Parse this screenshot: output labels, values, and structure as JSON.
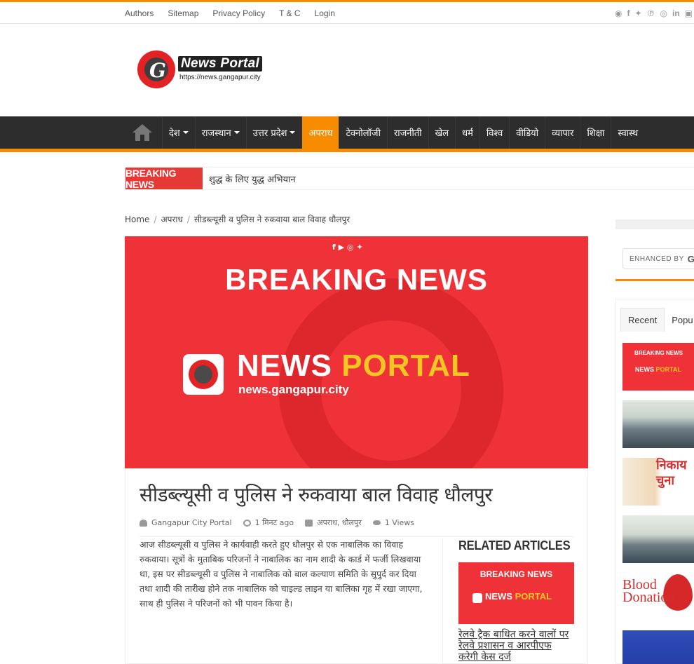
{
  "top_links": [
    "Authors",
    "Sitemap",
    "Privacy Policy",
    "T & C",
    "Login"
  ],
  "social_icons": [
    "rss-icon",
    "facebook-icon",
    "twitter-icon",
    "pinterest-icon",
    "dribbble-icon",
    "linkedin-icon",
    "youtube-icon"
  ],
  "logo": {
    "title": "News Portal",
    "url": "https://news.gangapur.city"
  },
  "nav": {
    "items": [
      {
        "label": "देश",
        "dropdown": true
      },
      {
        "label": "राजस्थान",
        "dropdown": true
      },
      {
        "label": "उत्तर प्रदेश",
        "dropdown": true
      },
      {
        "label": "अपराध",
        "active": true
      },
      {
        "label": "टेक्नोलॉजी"
      },
      {
        "label": "राजनीती"
      },
      {
        "label": "खेल"
      },
      {
        "label": "धर्म"
      },
      {
        "label": "विश्व"
      },
      {
        "label": "वीडियो"
      },
      {
        "label": "व्यापार"
      },
      {
        "label": "शिक्षा"
      },
      {
        "label": "स्वास्थ"
      }
    ]
  },
  "breaking": {
    "label": "BREAKING NEWS",
    "text": "शुद्ध के लिए युद्ध अभियान"
  },
  "breadcrumb": {
    "home": "Home",
    "category": "अपराध",
    "current": "सीडब्ल्यूसी व पुलिस ने रुकवाया बाल विवाह धौलपुर"
  },
  "hero": {
    "headline": "BREAKING NEWS",
    "brand_white": "NEWS ",
    "brand_yellow": "PORTAL",
    "url": "news.gangapur.city",
    "social": "f ▶ ◎ ✦"
  },
  "article": {
    "title": "सीडब्ल्यूसी व पुलिस ने रुकवाया बाल विवाह धौलपुर",
    "author": "Gangapur City Portal",
    "time": "1 मिनट ago",
    "categories": "अपराध, धौलपुर",
    "views": "1 Views",
    "body": "आज सीडब्ल्यूसी व पुलिस ने कार्यवाही करते हुए धौलपुर से एक नाबालिक का विवाह रुकवाया। सूत्रों के मुताबिक परिजनों ने नाबालिक का नाम शादी के कार्ड में फर्जी लिखवाया था, इस पर सीडब्ल्यूसी व पुलिस ने नाबालिक को बाल कल्याण समिति के सुपुर्द कर दिया तथा शादी की तारीख होने तक नाबालिक को चाइल्ड लाइन या बालिका गृह में रखा जाएगा, साथ ही पुलिस ने परिजनों को भी पावन किया है।"
  },
  "related": {
    "title": "RELATED ARTICLES",
    "thumb_headline": "BREAKING NEWS",
    "thumb_brand_white": "NEWS ",
    "thumb_brand_yellow": "PORTAL",
    "link": "रेलवे ट्रैक बाधित करने वालों पर रेलवे प्रशासन व आरपीएफ करेगी केस दर्ज"
  },
  "sidebar": {
    "search_label": "ENHANCED BY",
    "search_brand": "G",
    "tabs": [
      "Recent",
      "Popu"
    ],
    "thumb1_headline": "BREAKING NEWS",
    "thumb1_brand_white": "NEWS ",
    "thumb1_brand_yellow": "PORTAL",
    "thumb3_word": "निकाय चुना",
    "thumb5_word": "Blood Donation"
  },
  "colors": {
    "accent": "#f88c00",
    "nav_bg": "#2d2d2d",
    "breaking_red": "#e53935",
    "hero_red": "#ee3237",
    "brand_yellow": "#f5c524"
  }
}
